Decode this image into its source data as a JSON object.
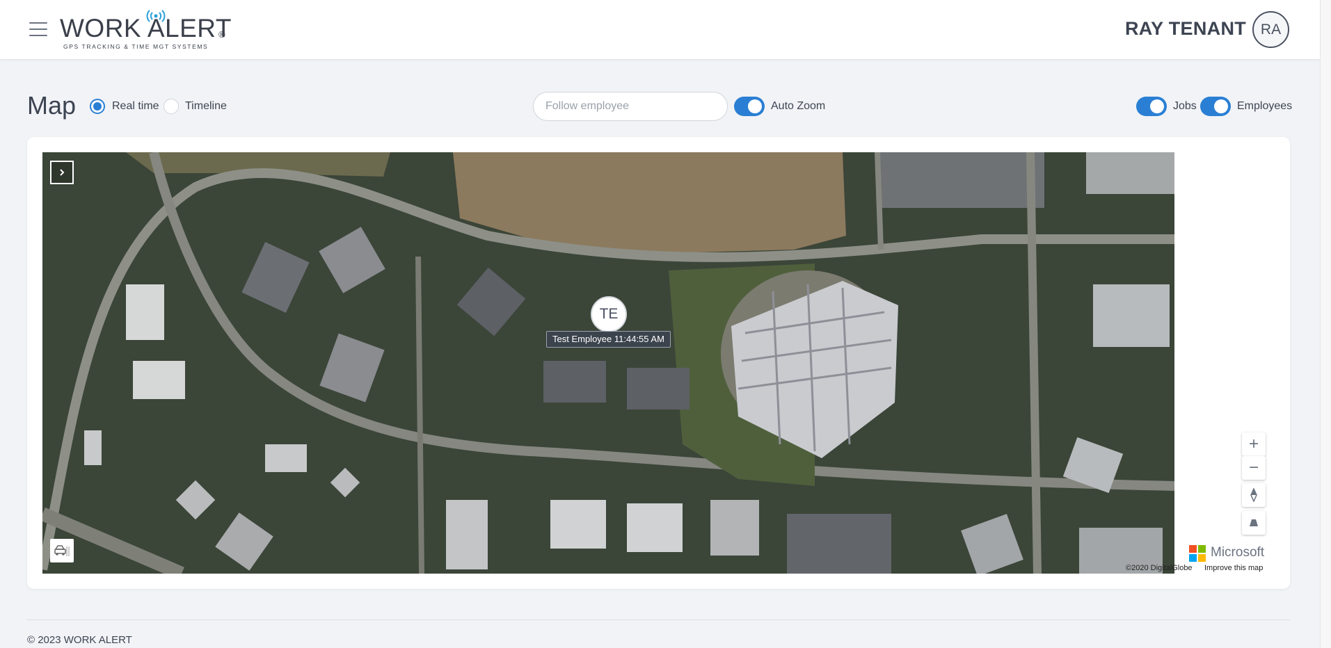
{
  "header": {
    "logo_text": "WORK ALERT",
    "logo_registered": "®",
    "logo_tagline": "GPS TRACKING & TIME MGT SYSTEMS",
    "user_name": "RAY TENANT",
    "avatar_initials": "RA"
  },
  "toolbar": {
    "title": "Map",
    "modes": [
      {
        "label": "Real time",
        "checked": true
      },
      {
        "label": "Timeline",
        "checked": false
      }
    ],
    "follow_placeholder": "Follow employee",
    "auto_zoom_label": "Auto Zoom",
    "jobs_label": "Jobs",
    "employees_label": "Employees"
  },
  "map": {
    "marker_initials": "TE",
    "marker_label": "Test Employee 11:44:55 AM",
    "attribution": "©2020 DigitalGlobe",
    "improve_link": "Improve this map",
    "provider": "Microsoft",
    "zoom_in": "+",
    "zoom_out": "−"
  },
  "footer": {
    "copyright": "© 2023 WORK ALERT"
  },
  "colors": {
    "accent": "#2a7fd4",
    "text": "#3d4452",
    "background": "#f1f3f6"
  }
}
